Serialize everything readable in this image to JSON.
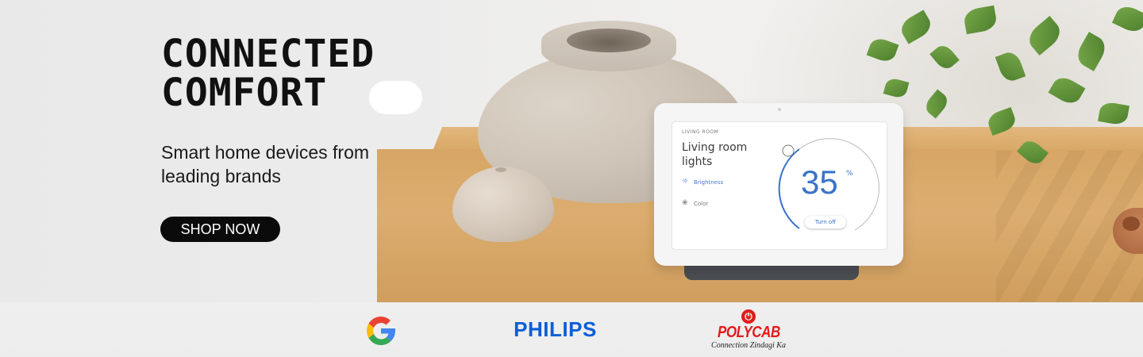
{
  "hero": {
    "headline_line1": "CONNECTED",
    "headline_line2": "COMFORT",
    "subtitle": "Smart home devices from leading brands",
    "cta_label": "SHOP NOW"
  },
  "device_screen": {
    "room": "LIVING ROOM",
    "title": "Living room lights",
    "brightness_label": "Brightness",
    "color_label": "Color",
    "value": "35",
    "unit": "%",
    "turn_off_label": "Turn off"
  },
  "brands": {
    "items": [
      {
        "name": "Google",
        "icon": "google-g-logo"
      },
      {
        "name": "PHILIPS",
        "icon": "philips-wordmark"
      },
      {
        "name": "POLYCAB",
        "icon": "polycab-logo",
        "tagline": "Connection Zindagi Ka"
      }
    ],
    "colors": {
      "philips": "#0B5ED7",
      "polycab": "#E21B1B",
      "google": [
        "#4285F4",
        "#34A853",
        "#FBBC05",
        "#EA4335"
      ]
    }
  },
  "colors": {
    "cta_background": "#0B0B0B",
    "cta_text": "#FFFFFF",
    "headline": "#111111",
    "accent_blue": "#3A73C9"
  }
}
